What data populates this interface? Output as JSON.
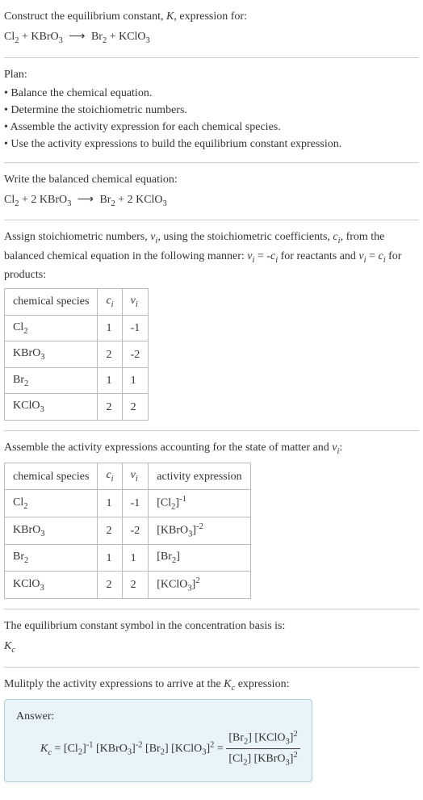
{
  "header": {
    "prompt": "Construct the equilibrium constant, ",
    "var": "K",
    "prompt2": ", expression for:",
    "equation": "Cl₂ + KBrO₃ ⟶ Br₂ + KClO₃"
  },
  "plan": {
    "title": "Plan:",
    "items": [
      "Balance the chemical equation.",
      "Determine the stoichiometric numbers.",
      "Assemble the activity expression for each chemical species.",
      "Use the activity expressions to build the equilibrium constant expression."
    ]
  },
  "balanced": {
    "title": "Write the balanced chemical equation:",
    "equation": "Cl₂ + 2 KBrO₃ ⟶ Br₂ + 2 KClO₃"
  },
  "stoich": {
    "intro": "Assign stoichiometric numbers, νᵢ, using the stoichiometric coefficients, cᵢ, from the balanced chemical equation in the following manner: νᵢ = -cᵢ for reactants and νᵢ = cᵢ for products:",
    "headers": [
      "chemical species",
      "cᵢ",
      "νᵢ"
    ],
    "rows": [
      [
        "Cl₂",
        "1",
        "-1"
      ],
      [
        "KBrO₃",
        "2",
        "-2"
      ],
      [
        "Br₂",
        "1",
        "1"
      ],
      [
        "KClO₃",
        "2",
        "2"
      ]
    ]
  },
  "activity": {
    "intro": "Assemble the activity expressions accounting for the state of matter and νᵢ:",
    "headers": [
      "chemical species",
      "cᵢ",
      "νᵢ",
      "activity expression"
    ],
    "rows": [
      {
        "species": "Cl₂",
        "c": "1",
        "v": "-1",
        "expr": "[Cl₂]⁻¹"
      },
      {
        "species": "KBrO₃",
        "c": "2",
        "v": "-2",
        "expr": "[KBrO₃]⁻²"
      },
      {
        "species": "Br₂",
        "c": "1",
        "v": "1",
        "expr": "[Br₂]"
      },
      {
        "species": "KClO₃",
        "c": "2",
        "v": "2",
        "expr": "[KClO₃]²"
      }
    ]
  },
  "symbol": {
    "line1": "The equilibrium constant symbol in the concentration basis is:",
    "kc": "K꜀"
  },
  "multiply": {
    "intro": "Mulitply the activity expressions to arrive at the K꜀ expression:"
  },
  "answer": {
    "label": "Answer:",
    "left": "K꜀ = [Cl₂]⁻¹ [KBrO₃]⁻² [Br₂] [KClO₃]² = ",
    "num": "[Br₂] [KClO₃]²",
    "den": "[Cl₂] [KBrO₃]²"
  }
}
